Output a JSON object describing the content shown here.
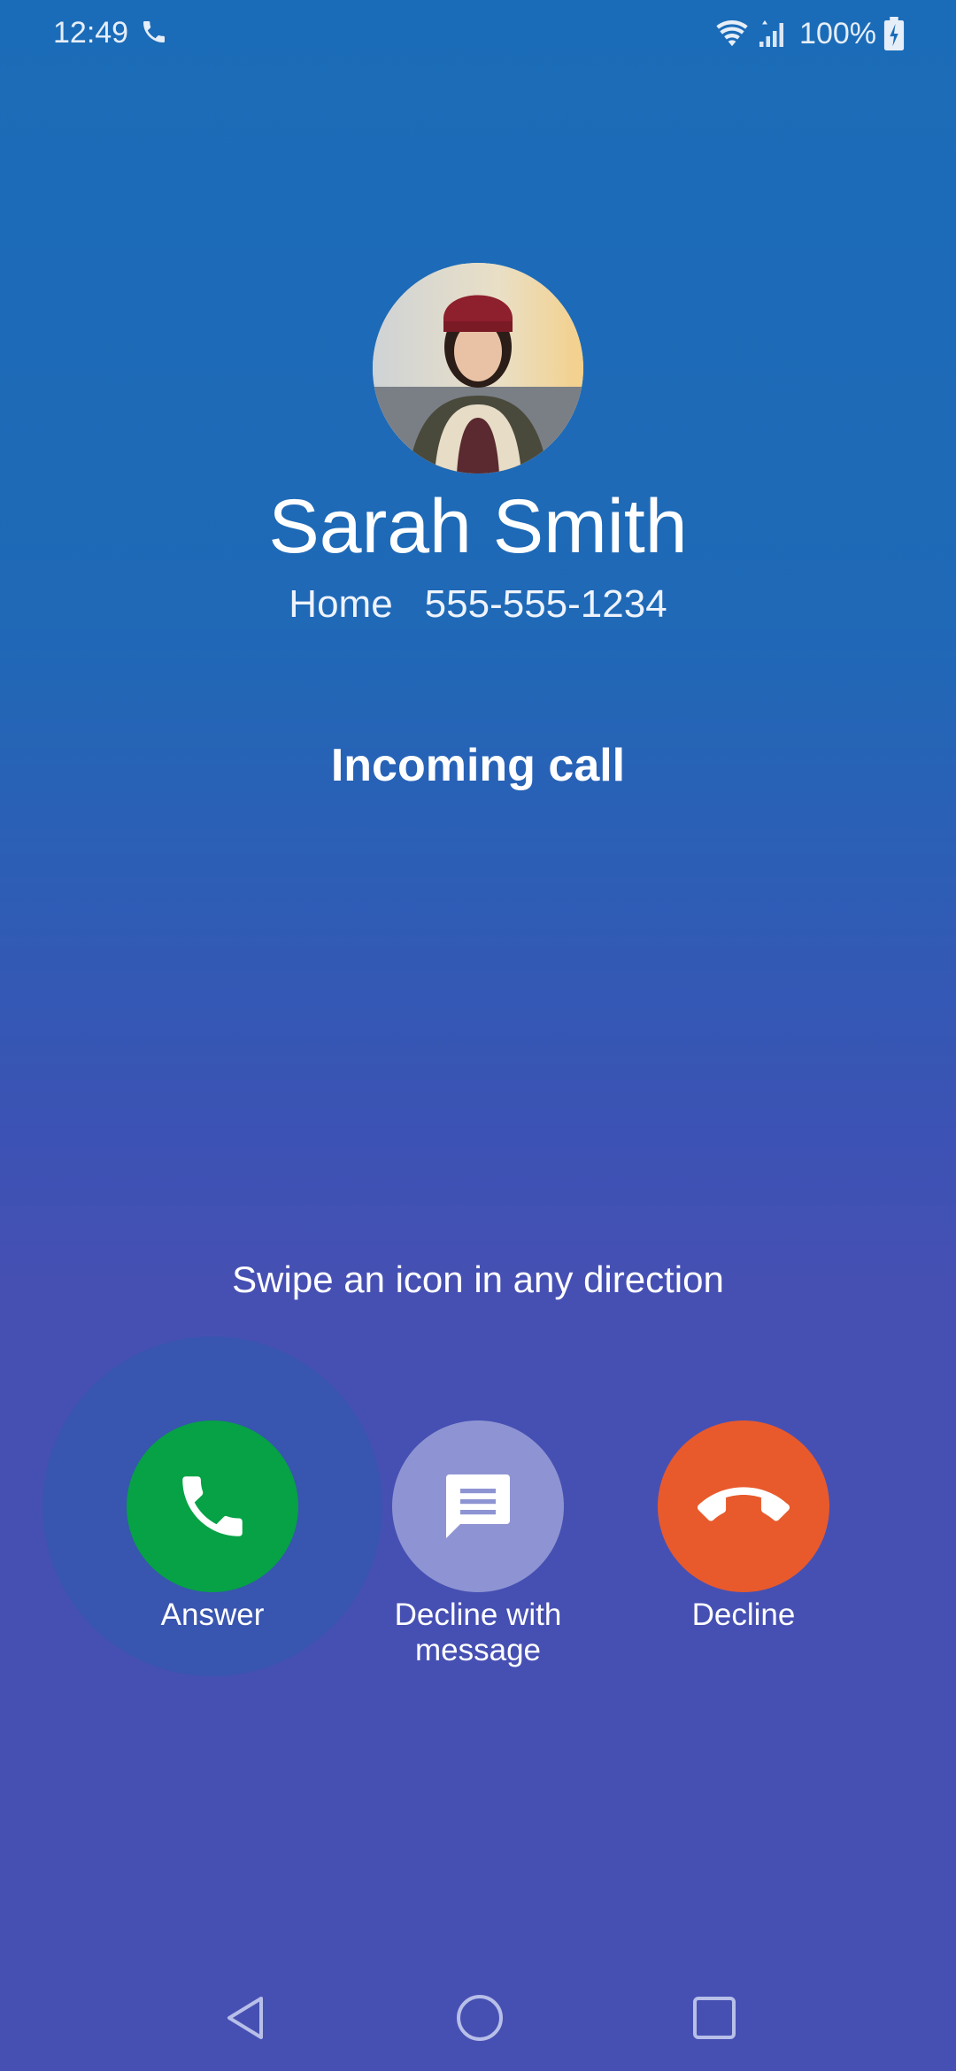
{
  "status_bar": {
    "time": "12:49",
    "battery": "100%",
    "icons": [
      "phone-call-icon",
      "wifi-icon",
      "signal-icon",
      "battery-charging-icon"
    ]
  },
  "caller": {
    "name": "Sarah Smith",
    "label": "Home",
    "number": "555-555-1234"
  },
  "call_status": "Incoming call",
  "swipe_hint": "Swipe an icon in any direction",
  "actions": [
    {
      "label": "Answer",
      "icon": "phone-answer-icon",
      "color": "#06a245"
    },
    {
      "label": "Decline with message",
      "icon": "message-icon",
      "color": "#8e94d3"
    },
    {
      "label": "Decline",
      "icon": "phone-decline-icon",
      "color": "#e85a2c"
    }
  ],
  "nav_bar": {
    "icons": [
      "back-icon",
      "home-icon",
      "recents-icon"
    ]
  }
}
